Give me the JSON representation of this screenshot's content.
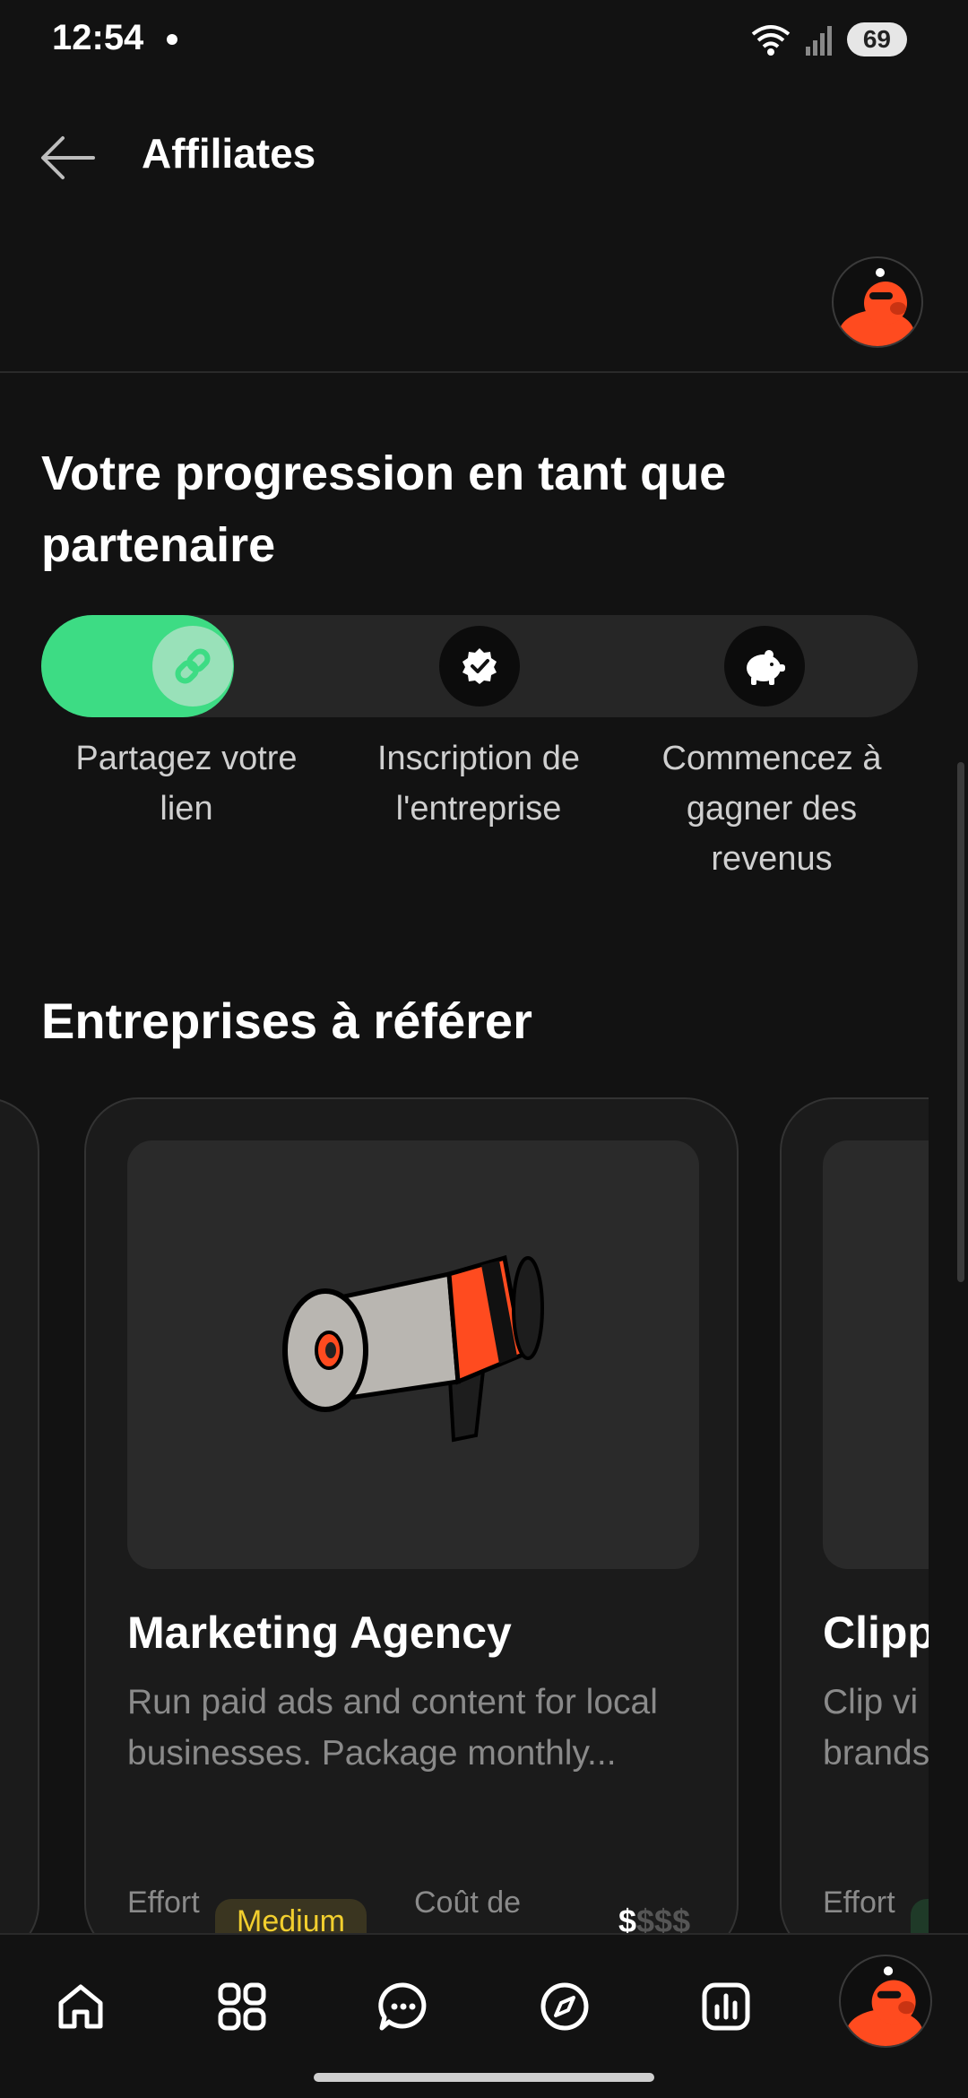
{
  "status_bar": {
    "time": "12:54",
    "battery": "69"
  },
  "header": {
    "title": "Affiliates"
  },
  "progress": {
    "title": "Votre progression en tant que partenaire",
    "completed_fraction": 0.22,
    "steps": [
      {
        "label": "Partagez votre lien",
        "icon": "link-icon",
        "state": "active"
      },
      {
        "label": "Inscription de l'entreprise",
        "icon": "verified-badge-icon",
        "state": "inactive"
      },
      {
        "label": "Commencez à gagner des revenus",
        "icon": "piggy-bank-icon",
        "state": "inactive"
      }
    ]
  },
  "businesses": {
    "title": "Entreprises à référer",
    "cards": [
      {
        "title": "Marketing Agency",
        "description": "Run paid ads and content for local businesses. Package monthly...",
        "image": "megaphone-illustration",
        "effort_label": "Effort",
        "effort_value": "Medium",
        "cost_label": "Coût de",
        "cost_on": "$",
        "cost_off": "$$$"
      },
      {
        "title": "Clipp",
        "description": "Clip vi brands",
        "effort_label": "Effort"
      }
    ]
  },
  "nav": {
    "items": [
      "home-icon",
      "grid-apps-icon",
      "chat-icon",
      "compass-icon",
      "analytics-icon",
      "profile-avatar"
    ]
  },
  "colors": {
    "accent": "#3ddc84",
    "brand": "#ff4b1f",
    "background": "#121212",
    "badge_text": "#f2cf2e"
  }
}
